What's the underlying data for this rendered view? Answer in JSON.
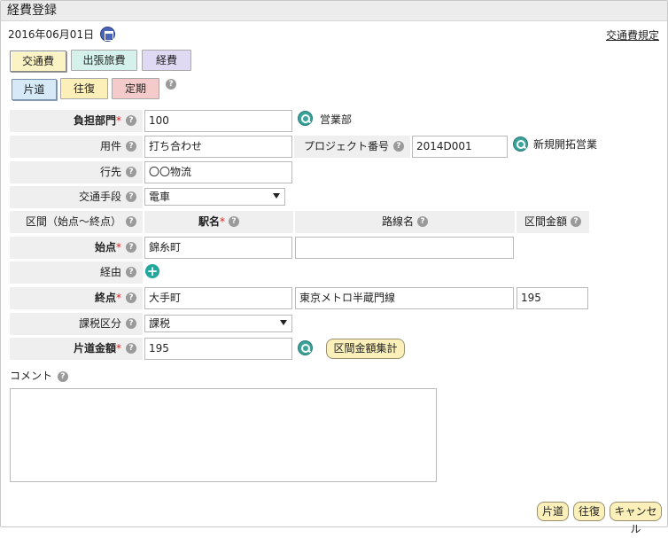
{
  "title": "経費登録",
  "date": "2016年06月01日",
  "rules_link": "交通費規定",
  "expense_tabs": [
    "交通費",
    "出張旅費",
    "経費"
  ],
  "trip_types": [
    "片道",
    "往復",
    "定期"
  ],
  "form": {
    "department": {
      "label": "負担部門",
      "value": "100",
      "name": "営業部"
    },
    "purpose": {
      "label": "用件",
      "value": "打ち合わせ"
    },
    "project": {
      "label": "プロジェクト番号",
      "value": "2014D001",
      "name": "新規開拓営業"
    },
    "destination": {
      "label": "行先",
      "value": "〇〇物流"
    },
    "transport": {
      "label": "交通手段",
      "value": "電車"
    },
    "section": {
      "label": "区間（始点～終点）",
      "col_station": "駅名",
      "col_line": "路線名",
      "col_amount": "区間金額"
    },
    "start": {
      "label": "始点",
      "station": "錦糸町",
      "line": ""
    },
    "via": {
      "label": "経由"
    },
    "end": {
      "label": "終点",
      "station": "大手町",
      "line": "東京メトロ半蔵門線",
      "amount": "195"
    },
    "tax": {
      "label": "課税区分",
      "value": "課税"
    },
    "oneway_amount": {
      "label": "片道金額",
      "value": "195"
    },
    "calc_button": "区間金額集計"
  },
  "comment": {
    "label": "コメント",
    "value": ""
  },
  "footer": {
    "oneway": "片道",
    "roundtrip": "往復",
    "cancel": "キャンセル"
  }
}
